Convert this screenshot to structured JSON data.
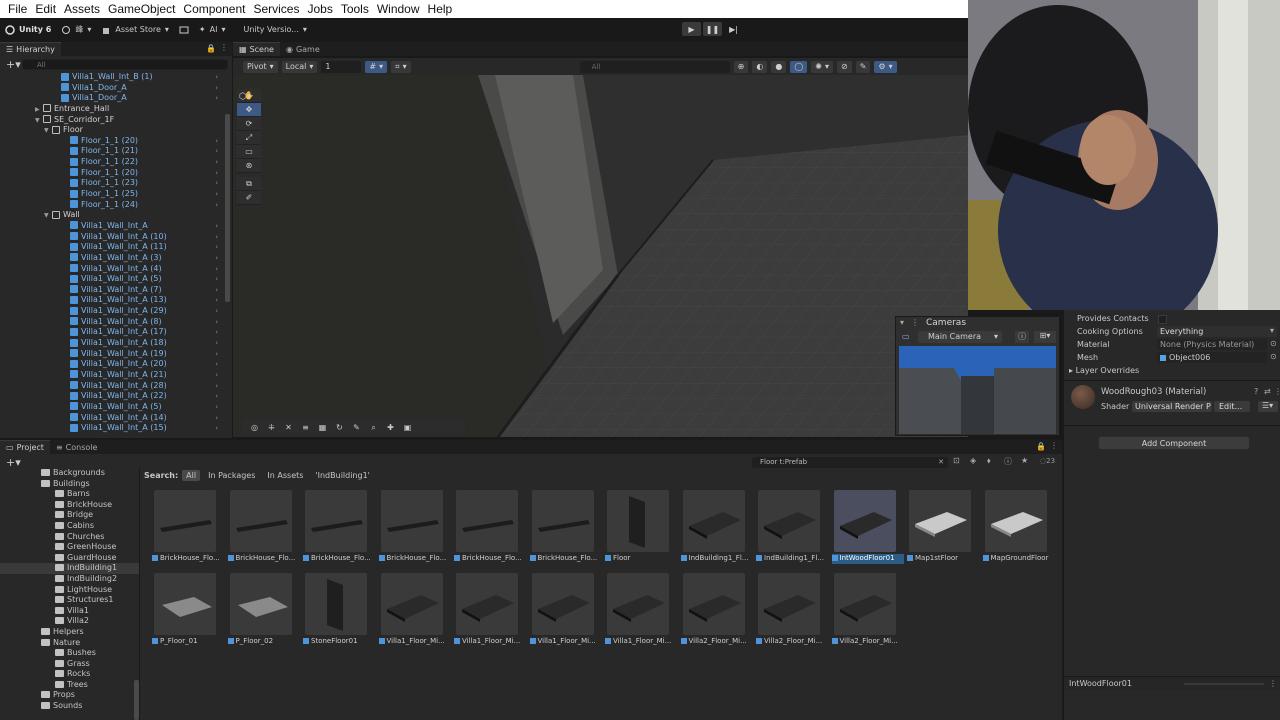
{
  "menu": [
    "File",
    "Edit",
    "Assets",
    "GameObject",
    "Component",
    "Services",
    "Jobs",
    "Tools",
    "Window",
    "Help"
  ],
  "toolbar": {
    "unity": "Unity 6",
    "account": "峰",
    "asset_store": "Asset Store",
    "ai": "AI",
    "version": "Unity Versio..."
  },
  "hierarchy": {
    "tab": "Hierarchy",
    "search_placeholder": "All",
    "rows": [
      {
        "label": "Villa1_Wall_Int_B (1)",
        "indent": 5,
        "kind": "prefab"
      },
      {
        "label": "Villa1_Door_A",
        "indent": 5,
        "kind": "prefab"
      },
      {
        "label": "Villa1_Door_A",
        "indent": 5,
        "kind": "prefab"
      },
      {
        "label": "Entrance_Hall",
        "indent": 3,
        "kind": "group",
        "tri": "▶"
      },
      {
        "label": "SE_Corridor_1F",
        "indent": 3,
        "kind": "group",
        "tri": "▼"
      },
      {
        "label": "Floor",
        "indent": 4,
        "kind": "group",
        "tri": "▼"
      },
      {
        "label": "Floor_1_1 (20)",
        "indent": 6,
        "kind": "prefab"
      },
      {
        "label": "Floor_1_1 (21)",
        "indent": 6,
        "kind": "prefab"
      },
      {
        "label": "Floor_1_1 (22)",
        "indent": 6,
        "kind": "prefab"
      },
      {
        "label": "Floor_1_1 (20)",
        "indent": 6,
        "kind": "prefab"
      },
      {
        "label": "Floor_1_1 (23)",
        "indent": 6,
        "kind": "prefab"
      },
      {
        "label": "Floor_1_1 (25)",
        "indent": 6,
        "kind": "prefab"
      },
      {
        "label": "Floor_1_1 (24)",
        "indent": 6,
        "kind": "prefab"
      },
      {
        "label": "Wall",
        "indent": 4,
        "kind": "group",
        "tri": "▼"
      },
      {
        "label": "Villa1_Wall_Int_A",
        "indent": 6,
        "kind": "prefab"
      },
      {
        "label": "Villa1_Wall_Int_A (10)",
        "indent": 6,
        "kind": "prefab"
      },
      {
        "label": "Villa1_Wall_Int_A (11)",
        "indent": 6,
        "kind": "prefab"
      },
      {
        "label": "Villa1_Wall_Int_A (3)",
        "indent": 6,
        "kind": "prefab"
      },
      {
        "label": "Villa1_Wall_Int_A (4)",
        "indent": 6,
        "kind": "prefab"
      },
      {
        "label": "Villa1_Wall_Int_A (5)",
        "indent": 6,
        "kind": "prefab"
      },
      {
        "label": "Villa1_Wall_Int_A (7)",
        "indent": 6,
        "kind": "prefab"
      },
      {
        "label": "Villa1_Wall_Int_A (13)",
        "indent": 6,
        "kind": "prefab"
      },
      {
        "label": "Villa1_Wall_Int_A (29)",
        "indent": 6,
        "kind": "prefab"
      },
      {
        "label": "Villa1_Wall_Int_A (8)",
        "indent": 6,
        "kind": "prefab"
      },
      {
        "label": "Villa1_Wall_Int_A (17)",
        "indent": 6,
        "kind": "prefab"
      },
      {
        "label": "Villa1_Wall_Int_A (18)",
        "indent": 6,
        "kind": "prefab"
      },
      {
        "label": "Villa1_Wall_Int_A (19)",
        "indent": 6,
        "kind": "prefab"
      },
      {
        "label": "Villa1_Wall_Int_A (20)",
        "indent": 6,
        "kind": "prefab"
      },
      {
        "label": "Villa1_Wall_Int_A (21)",
        "indent": 6,
        "kind": "prefab"
      },
      {
        "label": "Villa1_Wall_Int_A (28)",
        "indent": 6,
        "kind": "prefab"
      },
      {
        "label": "Villa1_Wall_Int_A (22)",
        "indent": 6,
        "kind": "prefab"
      },
      {
        "label": "Villa1_Wall_Int_A (5)",
        "indent": 6,
        "kind": "prefab"
      },
      {
        "label": "Villa1_Wall_Int_A (14)",
        "indent": 6,
        "kind": "prefab"
      },
      {
        "label": "Villa1_Wall_Int_A (15)",
        "indent": 6,
        "kind": "prefab"
      }
    ]
  },
  "scene": {
    "tabs": [
      "Scene",
      "Game"
    ],
    "pivot": "Pivot",
    "local": "Local",
    "grid_step": "1",
    "search_placeholder": "All"
  },
  "cameras": {
    "title": "Cameras",
    "selected": "Main Camera"
  },
  "inspector": {
    "provides_contacts": "Provides Contacts",
    "cooking_options_label": "Cooking Options",
    "cooking_options_value": "Everything",
    "material_label": "Material",
    "material_value": "None (Physics Material)",
    "mesh_label": "Mesh",
    "mesh_value": "Object006",
    "layer_overrides": "Layer Overrides",
    "material_name": "WoodRough03 (Material)",
    "shader_label": "Shader",
    "shader_value": "Universal Render P",
    "edit": "Edit...",
    "add_component": "Add Component",
    "preview_name": "IntWoodFloor01"
  },
  "project": {
    "tabs": [
      "Project",
      "Console"
    ],
    "search_value": "Floor t:Prefab",
    "count": "23",
    "filter_label": "Search:",
    "filter_chips": [
      "All",
      "In Packages",
      "In Assets",
      "'IndBuilding1'"
    ],
    "folders": [
      {
        "label": "Backgrounds",
        "indent": 5
      },
      {
        "label": "Buildings",
        "indent": 5
      },
      {
        "label": "Barns",
        "indent": 7
      },
      {
        "label": "BrickHouse",
        "indent": 7
      },
      {
        "label": "Bridge",
        "indent": 7
      },
      {
        "label": "Cabins",
        "indent": 7
      },
      {
        "label": "Churches",
        "indent": 7
      },
      {
        "label": "GreenHouse",
        "indent": 7
      },
      {
        "label": "GuardHouse",
        "indent": 7
      },
      {
        "label": "IndBuilding1",
        "indent": 7,
        "selected": true
      },
      {
        "label": "IndBuilding2",
        "indent": 7
      },
      {
        "label": "LightHouse",
        "indent": 7
      },
      {
        "label": "Structures1",
        "indent": 7
      },
      {
        "label": "Villa1",
        "indent": 7
      },
      {
        "label": "Villa2",
        "indent": 7
      },
      {
        "label": "Helpers",
        "indent": 5
      },
      {
        "label": "Nature",
        "indent": 5
      },
      {
        "label": "Bushes",
        "indent": 7
      },
      {
        "label": "Grass",
        "indent": 7
      },
      {
        "label": "Rocks",
        "indent": 7
      },
      {
        "label": "Trees",
        "indent": 7
      },
      {
        "label": "Props",
        "indent": 5
      },
      {
        "label": "Sounds",
        "indent": 5
      }
    ],
    "assets_row1": [
      "BrickHouse_Flo...",
      "BrickHouse_Flo...",
      "BrickHouse_Flo...",
      "BrickHouse_Flo...",
      "BrickHouse_Flo...",
      "BrickHouse_Flo...",
      "Floor",
      "IndBuilding1_Fl...",
      "IndBuilding1_Fl...",
      "IntWoodFloor01",
      "Map1stFloor",
      "MapGroundFloor"
    ],
    "assets_row2": [
      "P_Floor_01",
      "P_Floor_02",
      "StoneFloor01",
      "Villa1_Floor_Mi...",
      "Villa1_Floor_Mi...",
      "Villa1_Floor_Mi...",
      "Villa1_Floor_Mi...",
      "Villa2_Floor_Mi...",
      "Villa2_Floor_Mi...",
      "Villa2_Floor_Mi..."
    ],
    "selected_asset": "IntWoodFloor01"
  },
  "colors": {
    "accent_blue": "#3d5a86",
    "prefab_blue": "#7fb6ee",
    "selection": "#2c5d87"
  }
}
